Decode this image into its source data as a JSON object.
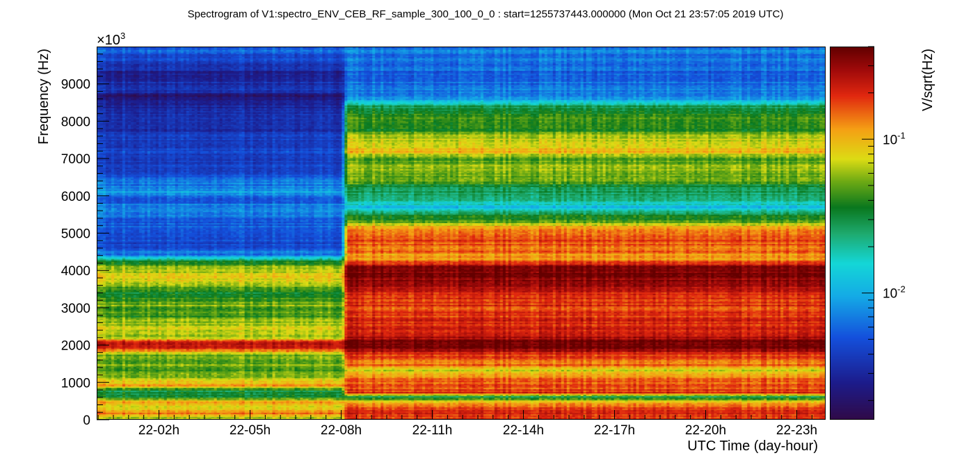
{
  "chart_data": {
    "type": "heatmap",
    "title": "Spectrogram of V1:spectro_ENV_CEB_RF_sample_300_100_0_0 : start=1255737443.000000 (Mon Oct 21 23:57:05 2019 UTC)",
    "xlabel": "UTC Time (day-hour)",
    "ylabel": "Frequency (Hz)",
    "y_multiplier_label": "×10",
    "y_multiplier_exp": "3",
    "zlabel": "V/sqrt(Hz)",
    "z_scale": "log",
    "zlim": [
      0.0015,
      0.4
    ],
    "xlim_hours": [
      23.95,
      47.95
    ],
    "ylim": [
      0,
      10000
    ],
    "x_ticks": [
      {
        "label": "22-02h",
        "hour": 26
      },
      {
        "label": "22-05h",
        "hour": 29
      },
      {
        "label": "22-08h",
        "hour": 32
      },
      {
        "label": "22-11h",
        "hour": 35
      },
      {
        "label": "22-14h",
        "hour": 38
      },
      {
        "label": "22-17h",
        "hour": 41
      },
      {
        "label": "22-20h",
        "hour": 44
      },
      {
        "label": "22-23h",
        "hour": 47
      }
    ],
    "y_ticks": [
      {
        "label": "0",
        "value": 0
      },
      {
        "label": "1000",
        "value": 1000
      },
      {
        "label": "2000",
        "value": 2000
      },
      {
        "label": "3000",
        "value": 3000
      },
      {
        "label": "4000",
        "value": 4000
      },
      {
        "label": "5000",
        "value": 5000
      },
      {
        "label": "6000",
        "value": 6000
      },
      {
        "label": "7000",
        "value": 7000
      },
      {
        "label": "8000",
        "value": 8000
      },
      {
        "label": "9000",
        "value": 9000
      }
    ],
    "z_ticks": [
      {
        "base": "10",
        "exp": "-1",
        "value": 0.1
      },
      {
        "base": "10",
        "exp": "-2",
        "value": 0.01
      }
    ],
    "change_hour": 32.1,
    "profile_before": [
      [
        0,
        0.06
      ],
      [
        150,
        0.15
      ],
      [
        300,
        0.08
      ],
      [
        450,
        0.12
      ],
      [
        600,
        0.035
      ],
      [
        750,
        0.03
      ],
      [
        900,
        0.12
      ],
      [
        1100,
        0.06
      ],
      [
        1300,
        0.045
      ],
      [
        1500,
        0.06
      ],
      [
        1700,
        0.05
      ],
      [
        1900,
        0.2
      ],
      [
        2050,
        0.25
      ],
      [
        2200,
        0.06
      ],
      [
        2500,
        0.07
      ],
      [
        2800,
        0.045
      ],
      [
        3100,
        0.055
      ],
      [
        3400,
        0.035
      ],
      [
        3600,
        0.055
      ],
      [
        3800,
        0.09
      ],
      [
        4100,
        0.06
      ],
      [
        4250,
        0.03
      ],
      [
        4400,
        0.007
      ],
      [
        4700,
        0.0045
      ],
      [
        5000,
        0.005
      ],
      [
        5400,
        0.006
      ],
      [
        5700,
        0.008
      ],
      [
        5900,
        0.005
      ],
      [
        6100,
        0.01
      ],
      [
        6300,
        0.007
      ],
      [
        6700,
        0.004
      ],
      [
        7200,
        0.0045
      ],
      [
        7800,
        0.0035
      ],
      [
        8300,
        0.0035
      ],
      [
        8700,
        0.002
      ],
      [
        8800,
        0.0035
      ],
      [
        9300,
        0.0028
      ],
      [
        9700,
        0.0045
      ],
      [
        10000,
        0.006
      ]
    ],
    "profile_after": [
      [
        0,
        0.2
      ],
      [
        200,
        0.22
      ],
      [
        400,
        0.14
      ],
      [
        600,
        0.03
      ],
      [
        700,
        0.2
      ],
      [
        900,
        0.16
      ],
      [
        1100,
        0.14
      ],
      [
        1300,
        0.07
      ],
      [
        1450,
        0.15
      ],
      [
        1700,
        0.18
      ],
      [
        1900,
        0.35
      ],
      [
        2100,
        0.35
      ],
      [
        2300,
        0.2
      ],
      [
        2700,
        0.2
      ],
      [
        3000,
        0.18
      ],
      [
        3400,
        0.22
      ],
      [
        3700,
        0.3
      ],
      [
        3900,
        0.38
      ],
      [
        4100,
        0.35
      ],
      [
        4300,
        0.1
      ],
      [
        4500,
        0.14
      ],
      [
        4800,
        0.17
      ],
      [
        5100,
        0.13
      ],
      [
        5300,
        0.055
      ],
      [
        5500,
        0.03
      ],
      [
        5700,
        0.012
      ],
      [
        5900,
        0.025
      ],
      [
        6200,
        0.03
      ],
      [
        6400,
        0.045
      ],
      [
        6700,
        0.06
      ],
      [
        7000,
        0.05
      ],
      [
        7200,
        0.1
      ],
      [
        7500,
        0.07
      ],
      [
        7800,
        0.04
      ],
      [
        8100,
        0.045
      ],
      [
        8400,
        0.03
      ],
      [
        8600,
        0.008
      ],
      [
        9000,
        0.006
      ],
      [
        9500,
        0.006
      ],
      [
        10000,
        0.007
      ]
    ]
  }
}
